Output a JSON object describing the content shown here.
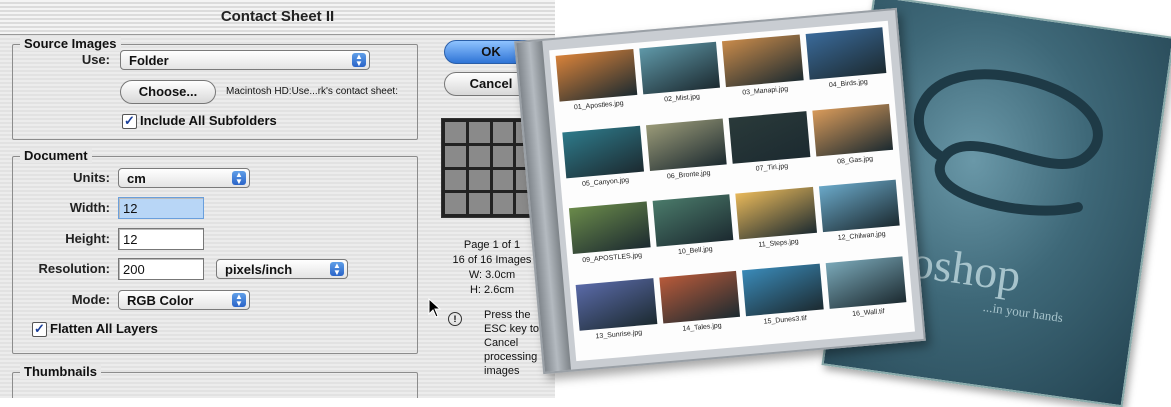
{
  "dialog": {
    "title": "Contact Sheet II",
    "source": {
      "legend": "Source Images",
      "use_label": "Use:",
      "use_value": "Folder",
      "choose_button": "Choose...",
      "path": "Macintosh HD:Use...rk's contact sheet:",
      "include_subfolders": "Include All Subfolders",
      "include_subfolders_checked": true
    },
    "document": {
      "legend": "Document",
      "units_label": "Units:",
      "units_value": "cm",
      "width_label": "Width:",
      "width_value": "12",
      "height_label": "Height:",
      "height_value": "12",
      "resolution_label": "Resolution:",
      "resolution_value": "200",
      "resolution_unit": "pixels/inch",
      "mode_label": "Mode:",
      "mode_value": "RGB Color",
      "flatten": "Flatten All Layers",
      "flatten_checked": true
    },
    "thumbnails": {
      "legend": "Thumbnails"
    },
    "ok_button": "OK",
    "cancel_button": "Cancel",
    "info": {
      "page": "Page 1 of 1",
      "images": "16 of 16 Images",
      "w": "W: 3.0cm",
      "h": "H: 2.6cm",
      "note": "Press the ESC key to Cancel processing images"
    }
  },
  "contact_sheet": {
    "thumbnails": [
      {
        "caption": "01_Apostles.jpg",
        "color": "#d8823a"
      },
      {
        "caption": "02_Mist.jpg",
        "color": "#5f98a8"
      },
      {
        "caption": "03_Manapi.jpg",
        "color": "#c88a4a"
      },
      {
        "caption": "04_Birds.jpg",
        "color": "#3a6a9a"
      },
      {
        "caption": "05_Canyon.jpg",
        "color": "#2e7a8a"
      },
      {
        "caption": "06_Bronte.jpg",
        "color": "#9a9a78"
      },
      {
        "caption": "07_Tiri.jpg",
        "color": "#2a3a3a"
      },
      {
        "caption": "08_Gas.jpg",
        "color": "#d89a5a"
      },
      {
        "caption": "09_APOSTLES.jpg",
        "color": "#6a8a4a"
      },
      {
        "caption": "10_Bell.jpg",
        "color": "#4a7a6a"
      },
      {
        "caption": "11_Steps.jpg",
        "color": "#e8b85a"
      },
      {
        "caption": "12_Chilwan.jpg",
        "color": "#6aa8c8"
      },
      {
        "caption": "13_Sunrise.jpg",
        "color": "#5a6aa8"
      },
      {
        "caption": "14_Tales.jpg",
        "color": "#b85a3a"
      },
      {
        "caption": "15_Dunes3.tif",
        "color": "#3a8ab8"
      },
      {
        "caption": "16_Wall.tif",
        "color": "#7aa8b8"
      }
    ]
  },
  "cd_cover": {
    "brand": "toshop",
    "tagline": "...in your hands"
  }
}
